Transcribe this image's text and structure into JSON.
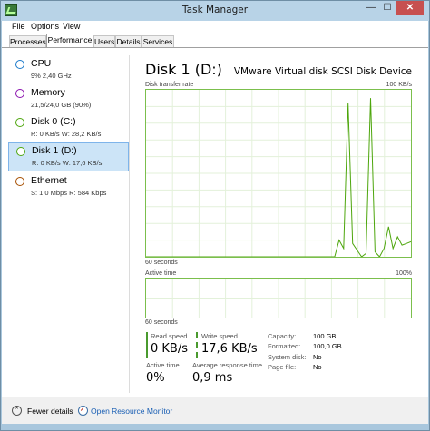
{
  "window": {
    "title": "Task Manager",
    "controls": {
      "minimize": "—",
      "maximize": "☐",
      "close": "✕"
    }
  },
  "menu": [
    "File",
    "Options",
    "View"
  ],
  "tabs": [
    {
      "label": "Processes",
      "active": false
    },
    {
      "label": "Performance",
      "active": true
    },
    {
      "label": "Users",
      "active": false
    },
    {
      "label": "Details",
      "active": false
    },
    {
      "label": "Services",
      "active": false
    }
  ],
  "sidebar": {
    "items": [
      {
        "name": "CPU",
        "sub": "9% 2,40 GHz",
        "ring_color": "#1979ca"
      },
      {
        "name": "Memory",
        "sub": "21,5/24,0 GB (90%)",
        "ring_color": "#8b12ae"
      },
      {
        "name": "Disk 0 (C:)",
        "sub": "R: 0 KB/s W: 28,2 KB/s",
        "ring_color": "#4da60c"
      },
      {
        "name": "Disk 1 (D:)",
        "sub": "R: 0 KB/s W: 17,6 KB/s",
        "ring_color": "#4da60c",
        "selected": true
      },
      {
        "name": "Ethernet",
        "sub": "S: 1,0 Mbps R: 584 Kbps",
        "ring_color": "#a74f01"
      }
    ]
  },
  "main": {
    "title": "Disk 1 (D:)",
    "model": "VMware Virtual disk SCSI Disk Device",
    "graph1": {
      "label": "Disk transfer rate",
      "max": "100 KB/s",
      "time": "60 seconds",
      "line_color": "#4da60c",
      "values": [
        0,
        0,
        0,
        0,
        0,
        0,
        0,
        0,
        0,
        0,
        0,
        0,
        0,
        0,
        0,
        0,
        0,
        0,
        0,
        0,
        0,
        0,
        0,
        0,
        0,
        0,
        0,
        0,
        0,
        0,
        0,
        0,
        0,
        0,
        0,
        0,
        0,
        0,
        0,
        0,
        0,
        0,
        0,
        0.1,
        0.05,
        0.92,
        0.08,
        0.04,
        0,
        0.02,
        0.95,
        0.03,
        0.0,
        0.05,
        0.18,
        0.05,
        0.12,
        0.07,
        0.08,
        0.09
      ]
    },
    "graph2": {
      "label": "Active time",
      "max": "100%",
      "time": "60 seconds"
    },
    "stats": {
      "read_speed_label": "Read speed",
      "read_speed": "0 KB/s",
      "write_speed_label": "Write speed",
      "write_speed": "17,6 KB/s",
      "active_time_label": "Active time",
      "active_time": "0%",
      "avg_response_label": "Average response time",
      "avg_response": "0,9 ms"
    },
    "properties": [
      {
        "key": "Capacity:",
        "value": "100 GB"
      },
      {
        "key": "Formatted:",
        "value": "100,0 GB"
      },
      {
        "key": "System disk:",
        "value": "No"
      },
      {
        "key": "Page file:",
        "value": "No"
      }
    ]
  },
  "footer": {
    "fewer_details": "Fewer details",
    "fewer_icon": "chevron-up-icon",
    "resource_monitor": "Open Resource Monitor",
    "resource_icon": "resource-monitor-icon"
  }
}
